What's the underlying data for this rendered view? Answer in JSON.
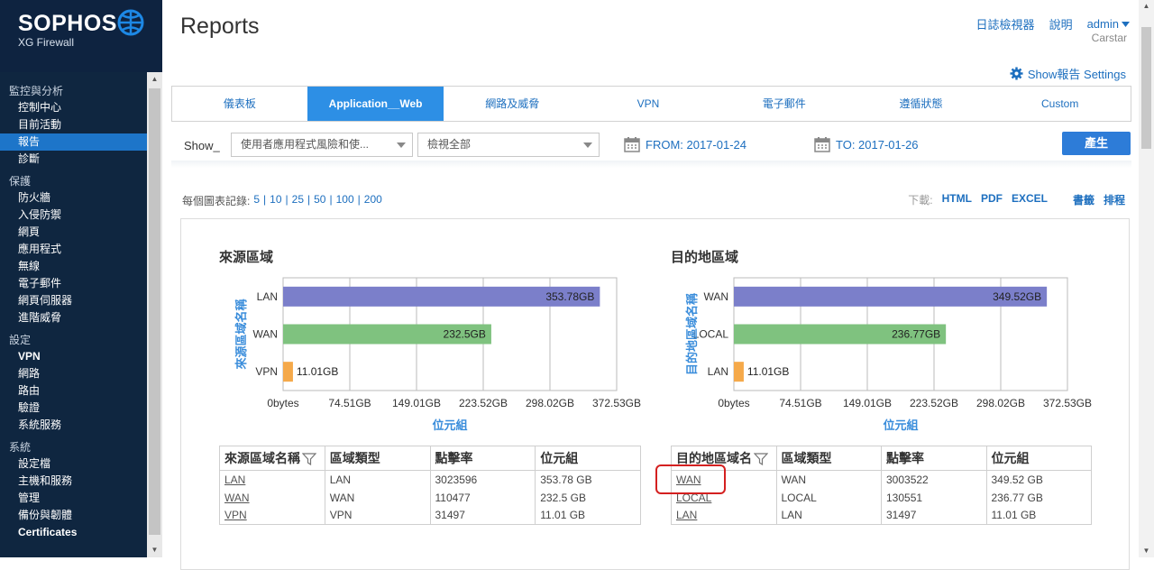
{
  "app": {
    "brand": "SOPHOS",
    "product": "XG Firewall"
  },
  "sidebar": {
    "sections": [
      {
        "title": "監控與分析",
        "items": [
          "控制中心",
          "目前活動",
          "報告",
          "診斷"
        ],
        "active_index": 2
      },
      {
        "title": "保護",
        "items": [
          "防火牆",
          "入侵防禦",
          "網頁",
          "應用程式",
          "無線",
          "電子郵件",
          "網頁伺服器",
          "進階威脅"
        ]
      },
      {
        "title": "設定",
        "items": [
          "VPN",
          "網路",
          "路由",
          "驗證",
          "系統服務"
        ],
        "bold_index": 0
      },
      {
        "title": "系統",
        "items": [
          "設定檔",
          "主機和服務",
          "管理",
          "備份與韌體",
          "Certificates"
        ],
        "bold_index": 4
      }
    ]
  },
  "header": {
    "title": "Reports",
    "log_viewer": "日誌檢視器",
    "help": "說明",
    "admin": "admin",
    "user": "Carstar",
    "show_settings": "Show報告 Settings"
  },
  "tabs": [
    {
      "label": "儀表板",
      "active": false
    },
    {
      "label": "Application__Web",
      "active": true
    },
    {
      "label": "網路及威脅",
      "active": false
    },
    {
      "label": "VPN",
      "active": false
    },
    {
      "label": "電子郵件",
      "active": false
    },
    {
      "label": "遵循狀態",
      "active": false
    },
    {
      "label": "Custom",
      "active": false
    }
  ],
  "filters": {
    "show_label": "Show_",
    "report_select": "使用者應用程式風險和使...",
    "view_select": "檢視全部",
    "from": "FROM: 2017-01-24",
    "to": "TO: 2017-01-26",
    "generate": "產生"
  },
  "records": {
    "label": "每個圖表記錄:",
    "options": [
      "5",
      "10",
      "25",
      "50",
      "100",
      "200"
    ]
  },
  "downloads": {
    "label": "下載:",
    "html": "HTML",
    "pdf": "PDF",
    "excel": "EXCEL",
    "bookmark": "書籤",
    "schedule": "排程"
  },
  "chart_data": [
    {
      "type": "bar",
      "title": "來源區域",
      "xlabel": "位元組",
      "ylabel": "來源區域名稱",
      "categories": [
        "LAN",
        "WAN",
        "VPN"
      ],
      "values": [
        353.78,
        232.5,
        11.01
      ],
      "value_labels": [
        "353.78GB",
        "232.5GB",
        "11.01GB"
      ],
      "colors": [
        "#7b7fca",
        "#7fc27f",
        "#f5a94a"
      ],
      "xlim": [
        0,
        372.53
      ],
      "ticks": [
        0,
        74.51,
        149.01,
        223.52,
        298.02,
        372.53
      ],
      "tick_labels": [
        "0bytes",
        "74.51GB",
        "149.01GB",
        "223.52GB",
        "298.02GB",
        "372.53GB"
      ]
    },
    {
      "type": "bar",
      "title": "目的地區域",
      "xlabel": "位元組",
      "ylabel": "目的地區域名稱",
      "categories": [
        "WAN",
        "LOCAL",
        "LAN"
      ],
      "values": [
        349.52,
        236.77,
        11.01
      ],
      "value_labels": [
        "349.52GB",
        "236.77GB",
        "11.01GB"
      ],
      "colors": [
        "#7b7fca",
        "#7fc27f",
        "#f5a94a"
      ],
      "xlim": [
        0,
        372.53
      ],
      "ticks": [
        0,
        74.51,
        149.01,
        223.52,
        298.02,
        372.53
      ],
      "tick_labels": [
        "0bytes",
        "74.51GB",
        "149.01GB",
        "223.52GB",
        "298.02GB",
        "372.53GB"
      ]
    }
  ],
  "tables": {
    "source": {
      "headers": [
        "來源區域名稱",
        "區域類型",
        "點擊率",
        "位元組"
      ],
      "rows": [
        [
          "LAN",
          "LAN",
          "3023596",
          "353.78 GB"
        ],
        [
          "WAN",
          "WAN",
          "110477",
          "232.5 GB"
        ],
        [
          "VPN",
          "VPN",
          "31497",
          "11.01 GB"
        ]
      ]
    },
    "destination": {
      "headers": [
        "目的地區域名",
        "區域類型",
        "點擊率",
        "位元組"
      ],
      "rows": [
        [
          "WAN",
          "WAN",
          "3003522",
          "349.52 GB"
        ],
        [
          "LOCAL",
          "LOCAL",
          "130551",
          "236.77 GB"
        ],
        [
          "LAN",
          "LAN",
          "31497",
          "11.01 GB"
        ]
      ]
    }
  }
}
